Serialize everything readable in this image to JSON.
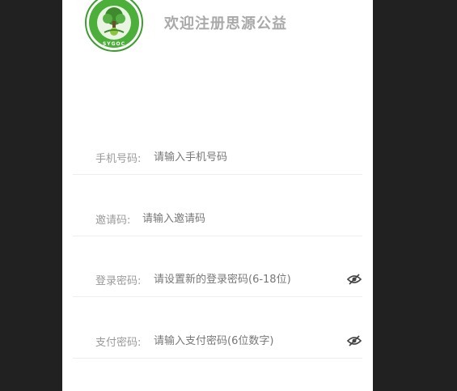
{
  "header": {
    "welcome_title": "欢迎注册思源公益",
    "logo_text": "SYGOC",
    "logo_icon": "tree-logo-icon"
  },
  "form": {
    "phone": {
      "label": "手机号码:",
      "value": "",
      "placeholder": "请输入手机号码"
    },
    "invite": {
      "label": "邀请码:",
      "value": "",
      "placeholder": "请输入邀请码"
    },
    "login_password": {
      "label": "登录密码:",
      "value": "",
      "placeholder": "请设置新的登录密码(6-18位)",
      "toggle_icon": "eye-hidden-icon"
    },
    "pay_password": {
      "label": "支付密码:",
      "value": "",
      "placeholder": "请输入支付密码(6位数字)",
      "toggle_icon": "eye-hidden-icon"
    }
  },
  "colors": {
    "background": "#212121",
    "card": "#ffffff",
    "logo_green": "#3e9b2f",
    "muted_text": "#9a9a9a"
  }
}
